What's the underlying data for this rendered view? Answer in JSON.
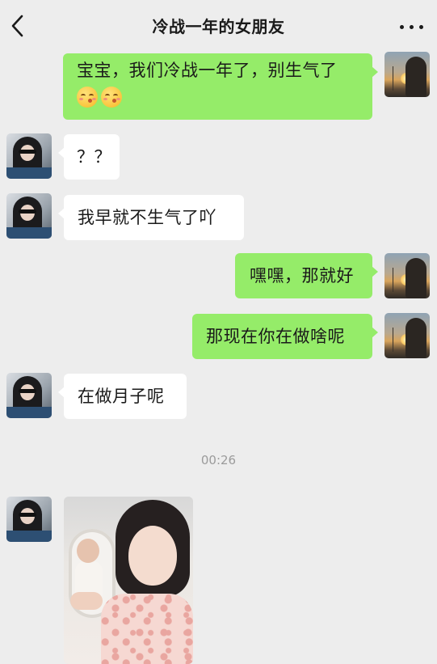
{
  "header": {
    "title": "冷战一年的女朋友"
  },
  "messages": [
    {
      "side": "sent",
      "text": "宝宝，我们冷战一年了，别生气了",
      "emoji": [
        "kiss-emoji",
        "kiss-emoji"
      ]
    },
    {
      "side": "recv",
      "text": "？？"
    },
    {
      "side": "recv",
      "text": "我早就不生气了吖"
    },
    {
      "side": "sent",
      "text": "嘿嘿，那就好"
    },
    {
      "side": "sent",
      "text": "那现在你在做啥呢"
    },
    {
      "side": "recv",
      "text": "在做月子呢"
    }
  ],
  "timestamp": "00:26",
  "last_message": {
    "side": "recv",
    "type": "image"
  },
  "icons": {
    "back": "chevron-left-icon",
    "more": "more-dots-icon"
  },
  "colors": {
    "background": "#ededed",
    "sent_bubble": "#95ec69",
    "recv_bubble": "#ffffff",
    "timestamp": "#9b9b9b"
  }
}
